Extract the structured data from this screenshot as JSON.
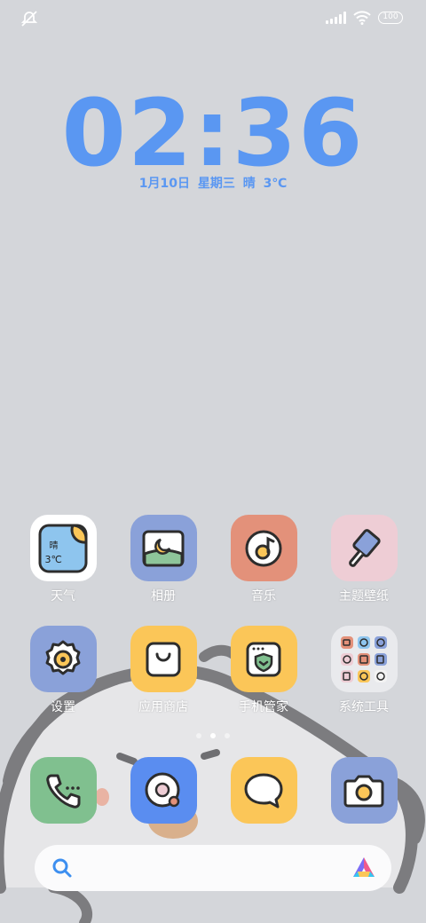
{
  "status_bar": {
    "left_icon": "silent-icon",
    "signal_icon": "signal-icon",
    "wifi_icon": "wifi-icon",
    "battery": "100"
  },
  "lockclock": {
    "time": "02:36",
    "date_text": "1月10日  星期三  晴  3℃"
  },
  "apps": [
    {
      "label": "天气",
      "icon": "weather-icon",
      "widget_text_1": "晴",
      "widget_text_2": "3℃"
    },
    {
      "label": "相册",
      "icon": "gallery-icon"
    },
    {
      "label": "音乐",
      "icon": "music-icon"
    },
    {
      "label": "主题壁纸",
      "icon": "themes-icon"
    },
    {
      "label": "设置",
      "icon": "settings-icon"
    },
    {
      "label": "应用商店",
      "icon": "app-store-icon"
    },
    {
      "label": "手机管家",
      "icon": "security-icon"
    },
    {
      "label": "系统工具",
      "icon": "system-tools-folder-icon"
    }
  ],
  "dock": [
    {
      "icon": "phone-icon"
    },
    {
      "icon": "browser-icon"
    },
    {
      "icon": "messages-icon"
    },
    {
      "icon": "camera-icon"
    }
  ],
  "pager": {
    "pages": 3,
    "active": 2
  },
  "search": {
    "search_icon": "search-icon",
    "assistant_icon": "assistant-icon"
  },
  "colors": {
    "clock": "#5a97f2",
    "background": "#d4d6da",
    "tile_blue": "#8aa1d9",
    "tile_orange": "#e3917a",
    "tile_pink": "#eecdd5",
    "tile_yellow": "#fbc658",
    "tile_green": "#80c08f"
  }
}
